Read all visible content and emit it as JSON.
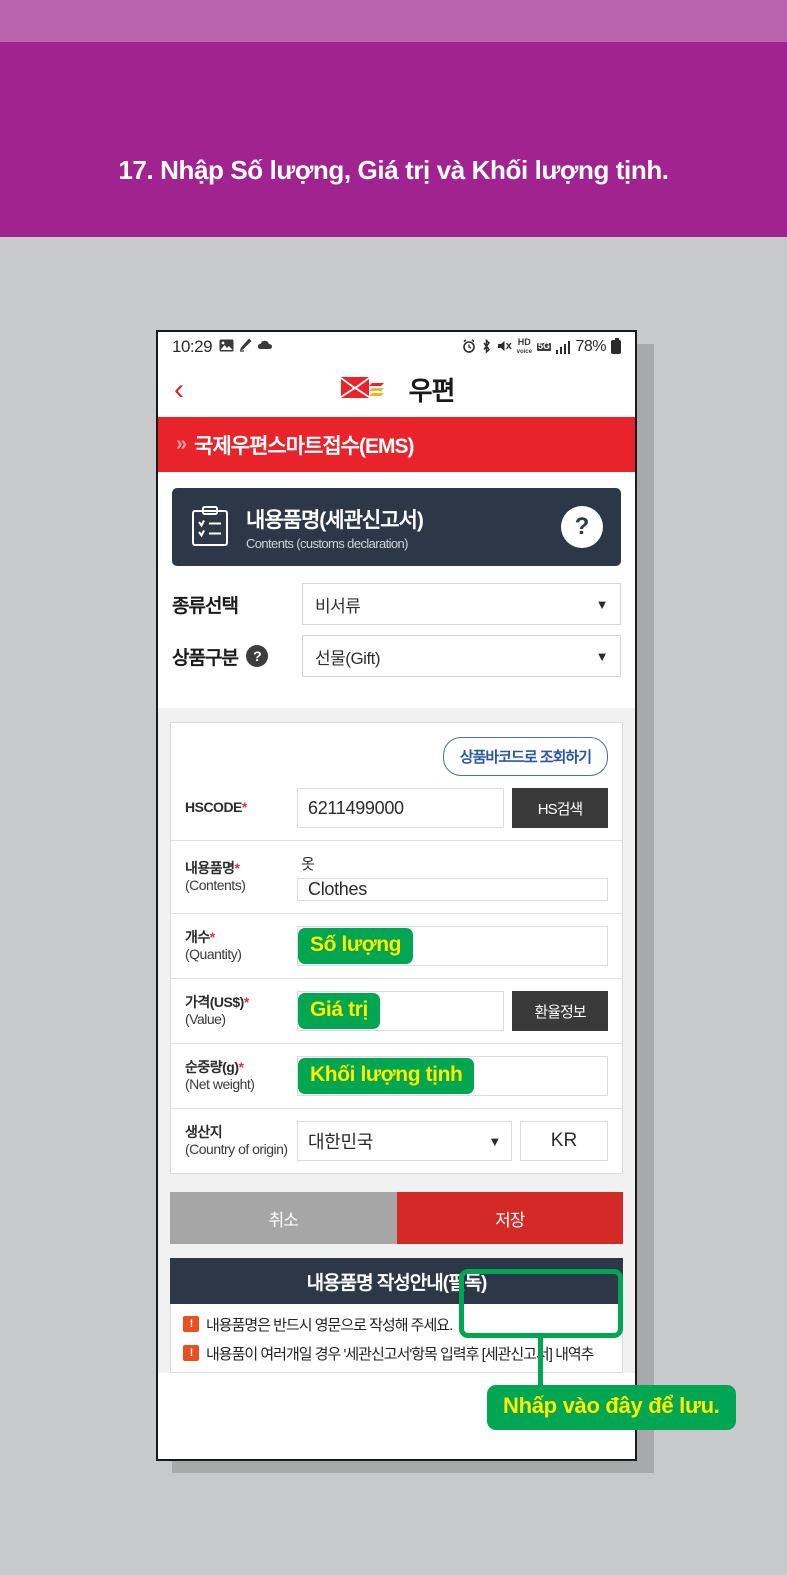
{
  "banner": {
    "title": "17. Nhập Số lượng, Giá trị và Khối lượng tịnh."
  },
  "phone": {
    "statusbar": {
      "time": "10:29",
      "left_icons": [
        "photo-icon",
        "edit-icon",
        "cloud-icon"
      ],
      "right_icons": [
        "alarm-icon",
        "bluetooth-icon",
        "mute-icon",
        "hd-voice-icon",
        "5g-icon",
        "signal-bars-icon"
      ],
      "hd_label": "HD",
      "hd_sub": "voice",
      "network_label": "5G",
      "battery_percent": "78%"
    },
    "titlebar": {
      "back_label": "‹",
      "brand_text": "우편"
    },
    "ems_bar": {
      "arrows": "»",
      "title": "국제우편스마트접수(EMS)"
    },
    "section_card": {
      "title_ko": "내용품명(세관신고서)",
      "title_en": "Contents (customs declaration)",
      "help_label": "?"
    },
    "selects": [
      {
        "label": "종류선택",
        "value": "비서류",
        "has_help": false,
        "caret": "▼"
      },
      {
        "label": "상품구분",
        "value": "선물(Gift)",
        "has_help": true,
        "help_label": "?",
        "caret": "▼"
      }
    ],
    "form": {
      "barcode_button": "상품바코드로 조회하기",
      "rows": [
        {
          "label_ko": "HSCODE",
          "label_en": "",
          "required": "*",
          "value": "6211499000",
          "button": "HS검색",
          "button_style": "dark",
          "annotation": null
        },
        {
          "label_ko": "내용품명",
          "label_en": "(Contents)",
          "required": "*",
          "preview": "옷",
          "value": "Clothes",
          "button": null,
          "annotation": null
        },
        {
          "label_ko": "개수",
          "label_en": "(Quantity)",
          "required": "*",
          "value": "",
          "button": null,
          "annotation": "Số lượng"
        },
        {
          "label_ko": "가격(US$)",
          "label_en": "(Value)",
          "required": "*",
          "value": "",
          "button": "환율정보",
          "button_style": "dark",
          "annotation": "Giá trị"
        },
        {
          "label_ko": "순중량(g)",
          "label_en": "(Net weight)",
          "required": "*",
          "value": "",
          "button": null,
          "annotation": "Khối lượng tịnh"
        },
        {
          "label_ko": "생산지",
          "label_en": "(Country of origin)",
          "required": "",
          "value": "대한민국",
          "caret": "▼",
          "button": "KR",
          "button_style": "plain",
          "annotation": null
        }
      ]
    },
    "actions": {
      "cancel": "취소",
      "save": "저장"
    },
    "notice": {
      "heading": "내용품명 작성안내(필독)",
      "bullet_glyph": "!",
      "lines": [
        "내용품명은 반드시 영문으로 작성해 주세요.",
        "내용품이 여러개일 경우 '세관신고서'항목 입력후 [세관신고서] 내역추"
      ]
    }
  },
  "callout": {
    "text": "Nhấp vào đây để lưu."
  },
  "colors": {
    "banner_light": "#bc63ae",
    "banner_dark": "#a02390",
    "page_bg": "#c8c9cb",
    "ems_red": "#e8232a",
    "card_navy": "#2c3848",
    "accent_green": "#00a651",
    "accent_yellow": "#ffec00",
    "save_red": "#d32a28",
    "cancel_grey": "#a6a6a6"
  }
}
